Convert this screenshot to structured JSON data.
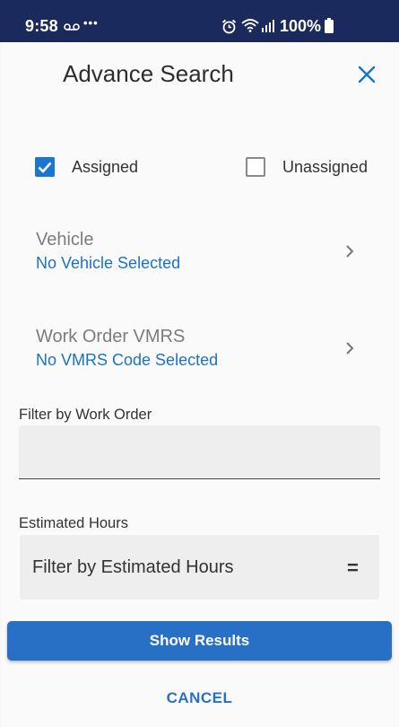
{
  "status_bar": {
    "time": "9:58",
    "dots": "•••",
    "battery": "100%",
    "icons": [
      "voicemail-icon",
      "alarm-icon",
      "wifi-icon",
      "signal-icon",
      "battery-icon"
    ]
  },
  "header": {
    "title": "Advance Search",
    "close_icon": "close-icon"
  },
  "filters": {
    "assigned": {
      "label": "Assigned",
      "checked": true
    },
    "unassigned": {
      "label": "Unassigned",
      "checked": false
    }
  },
  "vehicle": {
    "label": "Vehicle",
    "value": "No Vehicle Selected"
  },
  "vmrs": {
    "label": "Work Order VMRS",
    "value": "No VMRS Code Selected"
  },
  "work_order": {
    "label": "Filter by Work Order",
    "value": ""
  },
  "estimated_hours": {
    "label": "Estimated Hours",
    "placeholder": "Filter by Estimated Hours",
    "operator": "="
  },
  "actions": {
    "show_results": "Show Results",
    "cancel": "CANCEL"
  },
  "colors": {
    "status_bar": "#1b2a5c",
    "accent": "#1976d2",
    "button": "#2870c6",
    "link_text": "#1a73c6"
  }
}
